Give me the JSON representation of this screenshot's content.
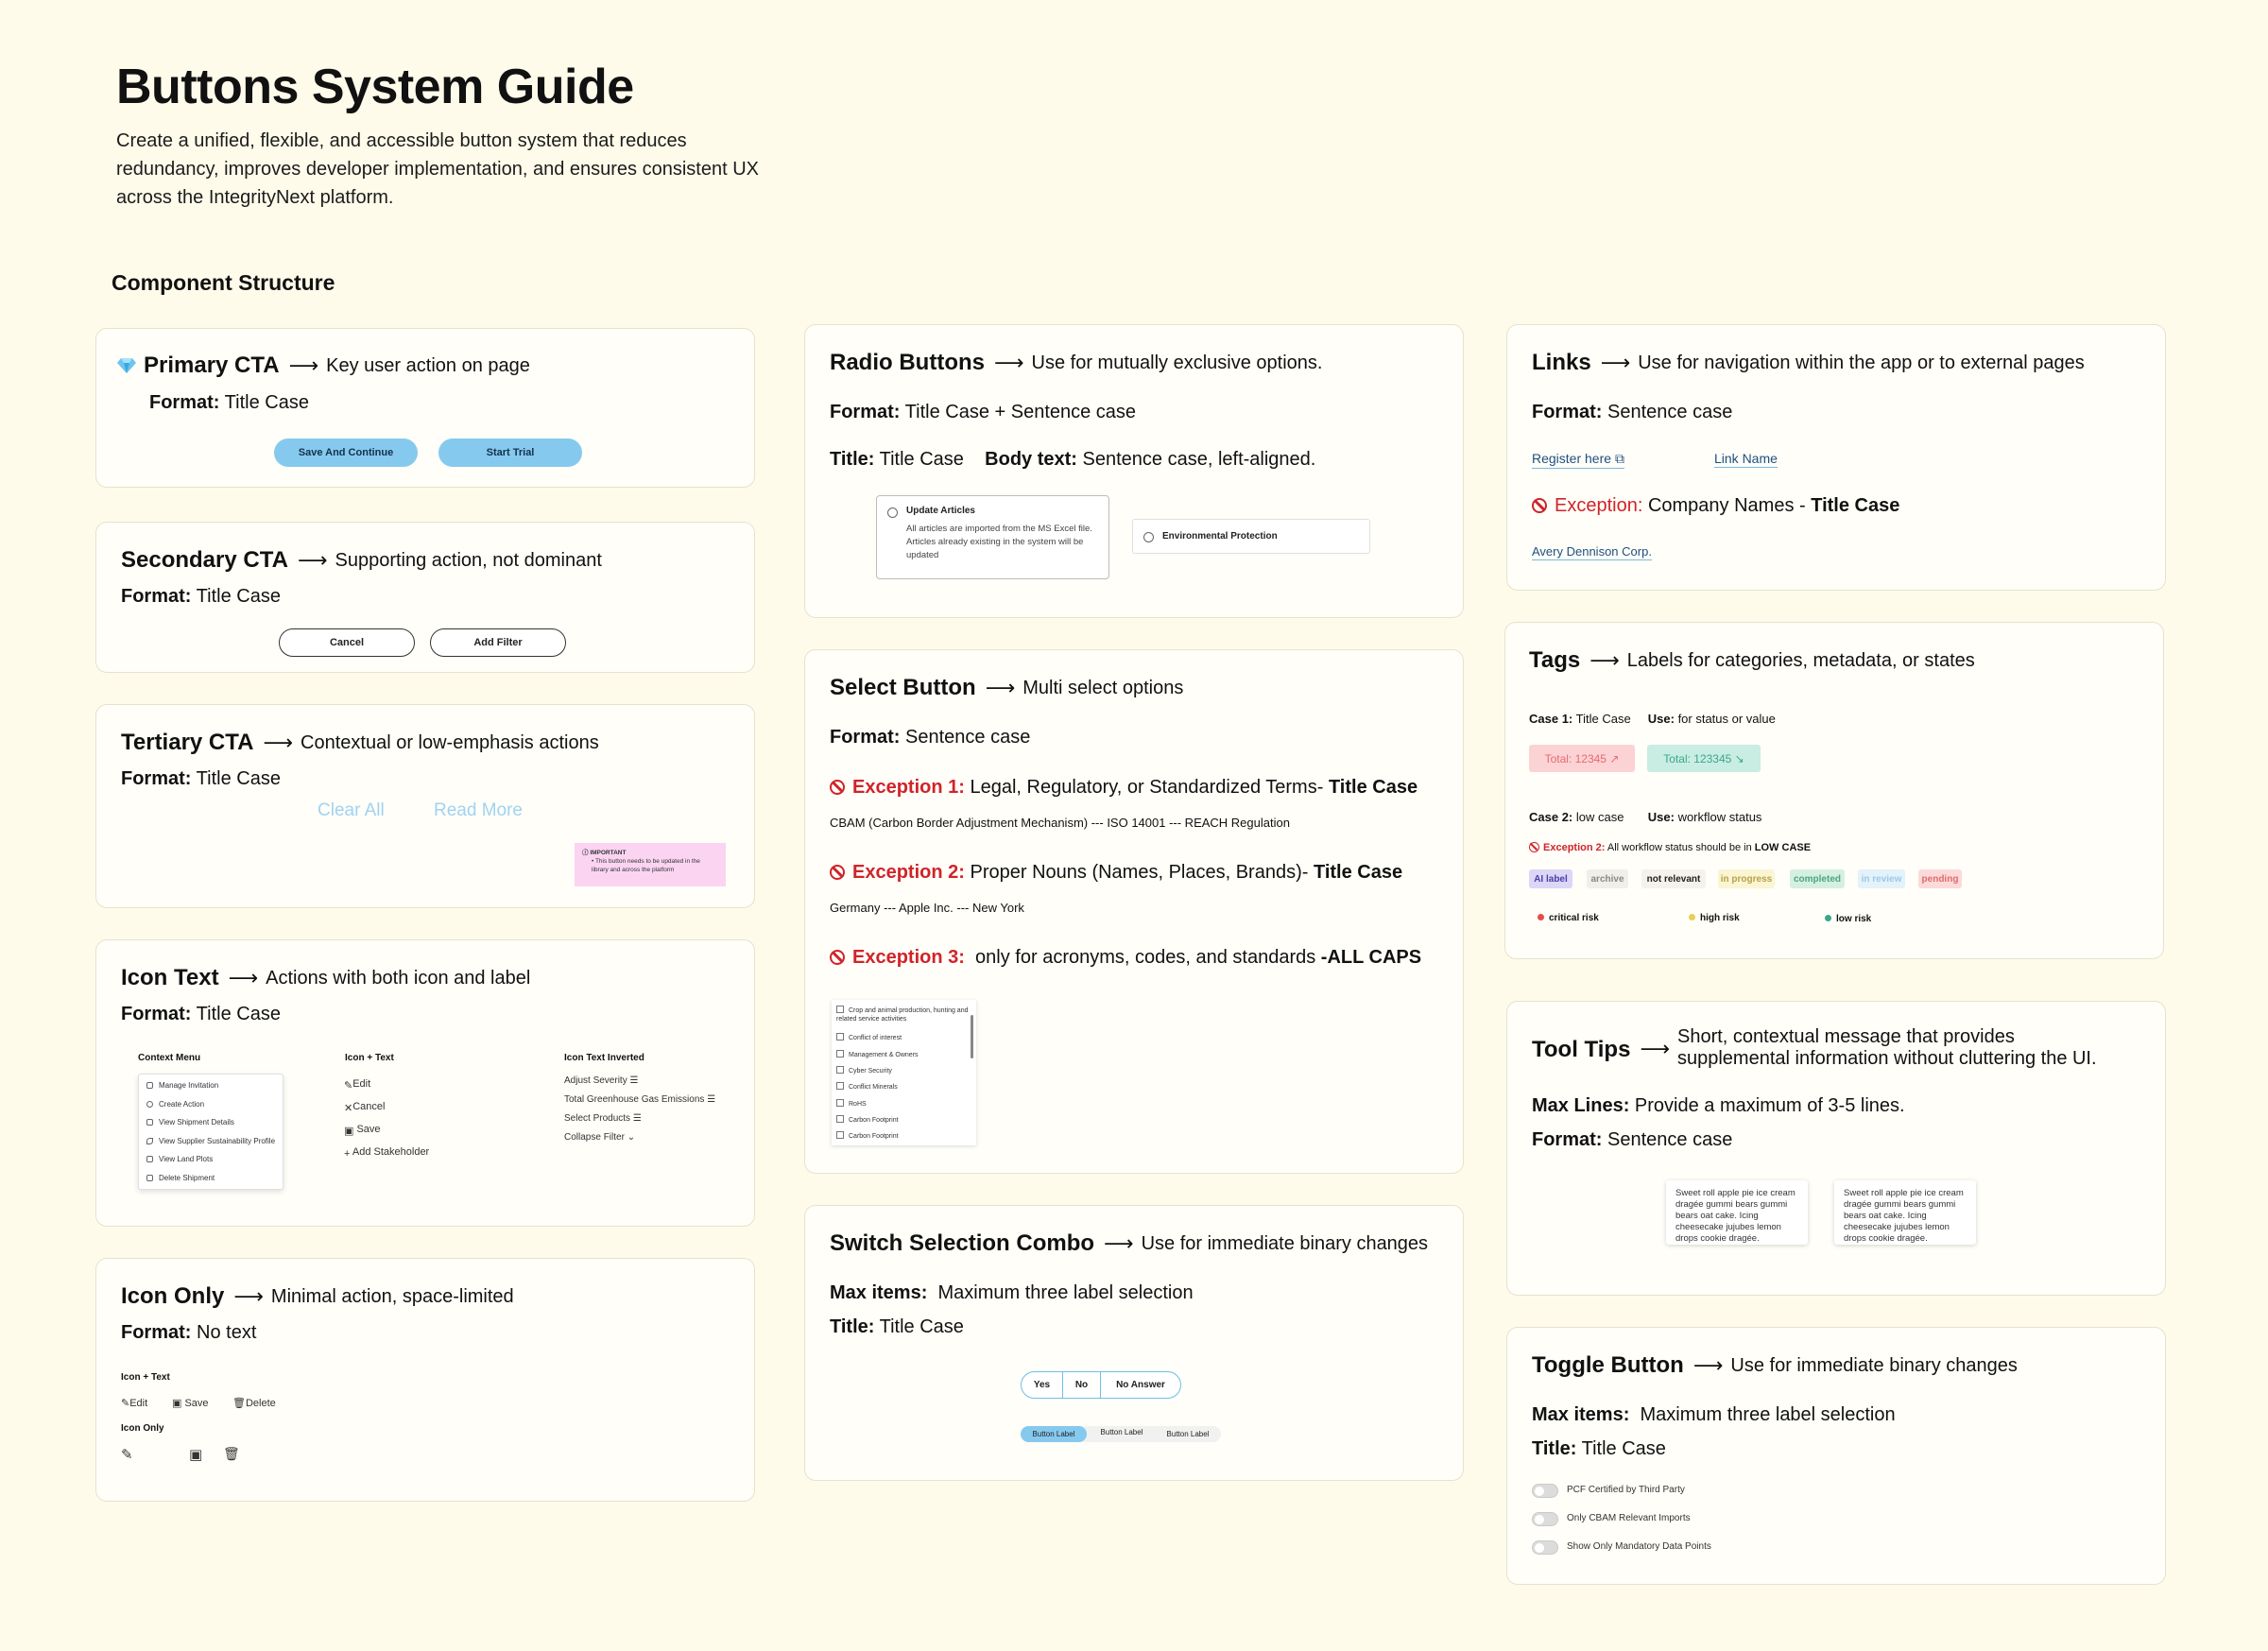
{
  "title": "Buttons System Guide",
  "intro": "Create a unified, flexible, and accessible button system that reduces redundancy, improves developer implementation, and ensures consistent UX across the IntegrityNext platform.",
  "section_label": "Component Structure",
  "common": {
    "arrow": "⟶",
    "format_label": "Format:",
    "title_label": "Title:",
    "max_items_label": "Max items:"
  },
  "primary": {
    "title": "Primary CTA",
    "desc": "Key user action on page",
    "format": "Title Case",
    "btn1": "Save And Continue",
    "btn2": "Start Trial"
  },
  "secondary": {
    "title": "Secondary CTA",
    "desc": "Supporting action, not dominant",
    "format": "Title Case",
    "btn1": "Cancel",
    "btn2": "Add Filter"
  },
  "tertiary": {
    "title": "Tertiary CTA",
    "desc": "Contextual or low-emphasis actions",
    "format": "Title Case",
    "link1": "Clear All",
    "link2": "Read More",
    "note_title": "IMPORTANT",
    "note_body": "• This button needs to be updated in the library and across the platform"
  },
  "icon_text": {
    "title": "Icon Text",
    "desc": "Actions with both icon and label",
    "format": "Title Case",
    "col1": "Context Menu",
    "col2": "Icon + Text",
    "col3": "Icon Text Inverted",
    "menu": [
      "Manage Invitation",
      "Create Action",
      "View Shipment Details",
      "View Supplier Sustainability Profile",
      "View Land Plots",
      "Delete Shipment"
    ],
    "icon_items": [
      "Edit",
      "Cancel",
      "Save",
      "Add Stakeholder"
    ],
    "inverted": [
      "Adjust Severity",
      "Total Greenhouse Gas Emissions",
      "Select Products",
      "Collapse Filter"
    ]
  },
  "icon_only": {
    "title": "Icon Only",
    "desc": "Minimal action, space-limited",
    "format": "No text",
    "label1": "Icon + Text",
    "items": [
      "Edit",
      "Save",
      "Delete"
    ],
    "label2": "Icon Only"
  },
  "radio": {
    "title": "Radio Buttons",
    "desc": "Use for mutually exclusive options.",
    "format": "Title Case + Sentence case",
    "title_val": "Title Case",
    "body_label": "Body text:",
    "body_val": "Sentence case, left-aligned.",
    "opt1_title": "Update Articles",
    "opt1_body": "All articles are imported from the MS Excel file. Articles already existing in the system will be updated",
    "opt2_title": "Environmental Protection"
  },
  "select": {
    "title": "Select Button",
    "desc": "Multi select options",
    "format": "Sentence case",
    "exc1_label": "Exception 1:",
    "exc1_text": "Legal, Regulatory, or Standardized Terms-",
    "exc1_bold": "Title Case",
    "exc1_example": "CBAM (Carbon Border Adjustment Mechanism) --- ISO 14001 --- REACH Regulation",
    "exc2_label": "Exception 2:",
    "exc2_text": "Proper Nouns (Names, Places, Brands)-",
    "exc2_bold": "Title Case",
    "exc2_example": "Germany --- Apple Inc. --- New York",
    "exc3_label": "Exception 3:",
    "exc3_text": "only for acronyms, codes, and standards",
    "exc3_bold": "-ALL CAPS",
    "list": [
      "Crop and animal production, hunting and related service activities",
      "Conflict of interest",
      "Management & Owners",
      "Cyber Security",
      "Conflict Minerals",
      "RoHS",
      "Carbon Footprint",
      "Carbon Footprint"
    ]
  },
  "switch": {
    "title": "Switch Selection Combo",
    "desc": "Use for immediate binary changes",
    "max_val": "Maximum three label selection",
    "title_val": "Title Case",
    "seg": [
      "Yes",
      "No",
      "No Answer"
    ],
    "combo": [
      "Button Label",
      "Button Label",
      "Button Label"
    ]
  },
  "links": {
    "title": "Links",
    "desc": "Use for navigation within the app or to external pages",
    "format": "Sentence case",
    "link1": "Register here",
    "link2": "Link Name",
    "exc_label": "Exception:",
    "exc_text": "Company Names -",
    "exc_bold": "Title Case",
    "company": "Avery Dennison Corp."
  },
  "tags": {
    "title": "Tags",
    "desc": "Labels for categories, metadata, or states",
    "case1_label": "Case 1:",
    "case1_val": "Title Case",
    "use_label": "Use:",
    "use1": "for status or value",
    "total1": "Total: 12345",
    "total2": "Total: 123345",
    "case2_label": "Case 2:",
    "case2_val": "low case",
    "use2": "workflow status",
    "exc_label": "Exception 2:",
    "exc_text": "All workflow status should be in",
    "exc_bold": "LOW CASE",
    "states": [
      "AI label",
      "archive",
      "not relevant",
      "in progress",
      "completed",
      "in review",
      "pending"
    ],
    "risks": [
      "critical risk",
      "high risk",
      "low risk"
    ],
    "colors": {
      "total_up_bg": "#fbd3d4",
      "total_up_fg": "#e76a70",
      "total_down_bg": "#c9ede3",
      "total_down_fg": "#3aa789"
    }
  },
  "tooltips": {
    "title": "Tool Tips",
    "desc": "Short, contextual message that provides supplemental information without cluttering the UI.",
    "max_lines_label": "Max Lines:",
    "max_lines": "Provide a maximum of 3-5 lines.",
    "format": "Sentence case",
    "tip_text": "Sweet roll apple pie ice cream dragée gummi bears gummi bears oat cake. Icing cheesecake jujubes lemon drops cookie dragée."
  },
  "toggle": {
    "title": "Toggle Button",
    "desc": "Use for immediate binary changes",
    "max_val": "Maximum three label selection",
    "title_val": "Title Case",
    "items": [
      "PCF Certified by Third Party",
      "Only CBAM Relevant Imports",
      "Show Only Mandatory Data Points"
    ]
  }
}
